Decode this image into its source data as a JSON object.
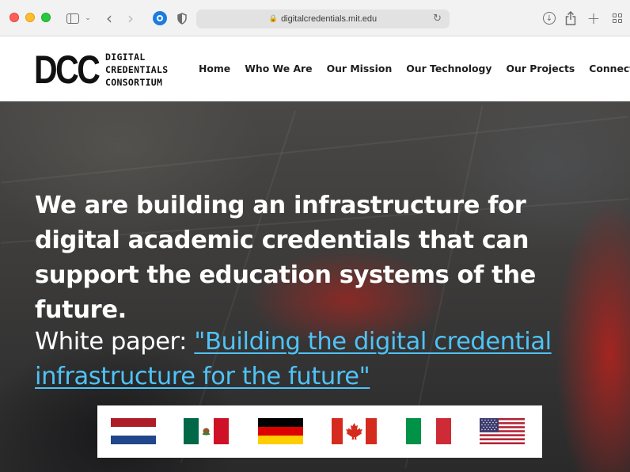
{
  "browser": {
    "url": "digitalcredentials.mit.edu",
    "icons": [
      "sidebar-icon",
      "chevron-down-icon",
      "back-arrow-icon",
      "forward-arrow-icon",
      "password-manager-icon",
      "privacy-shield-icon",
      "lock-icon",
      "reload-icon",
      "download-icon",
      "share-icon",
      "new-tab-icon",
      "tab-overview-icon"
    ]
  },
  "header": {
    "logo_mark": "DCC",
    "logo_words": [
      "DIGITAL",
      "CREDENTIALS",
      "CONSORTIUM"
    ],
    "nav": [
      "Home",
      "Who We Are",
      "Our Mission",
      "Our Technology",
      "Our Projects",
      "Connect"
    ]
  },
  "hero": {
    "headline": "We are building an infrastructure for digital academic credentials that can support the education systems of the future.",
    "whitepaper_prefix": "White paper: ",
    "whitepaper_link": "\"Building the digital credential infrastructure for the future\"",
    "link_color": "#4fc3f7"
  },
  "flags": [
    "netherlands-flag",
    "mexico-flag",
    "germany-flag",
    "canada-flag",
    "italy-flag",
    "usa-flag"
  ]
}
